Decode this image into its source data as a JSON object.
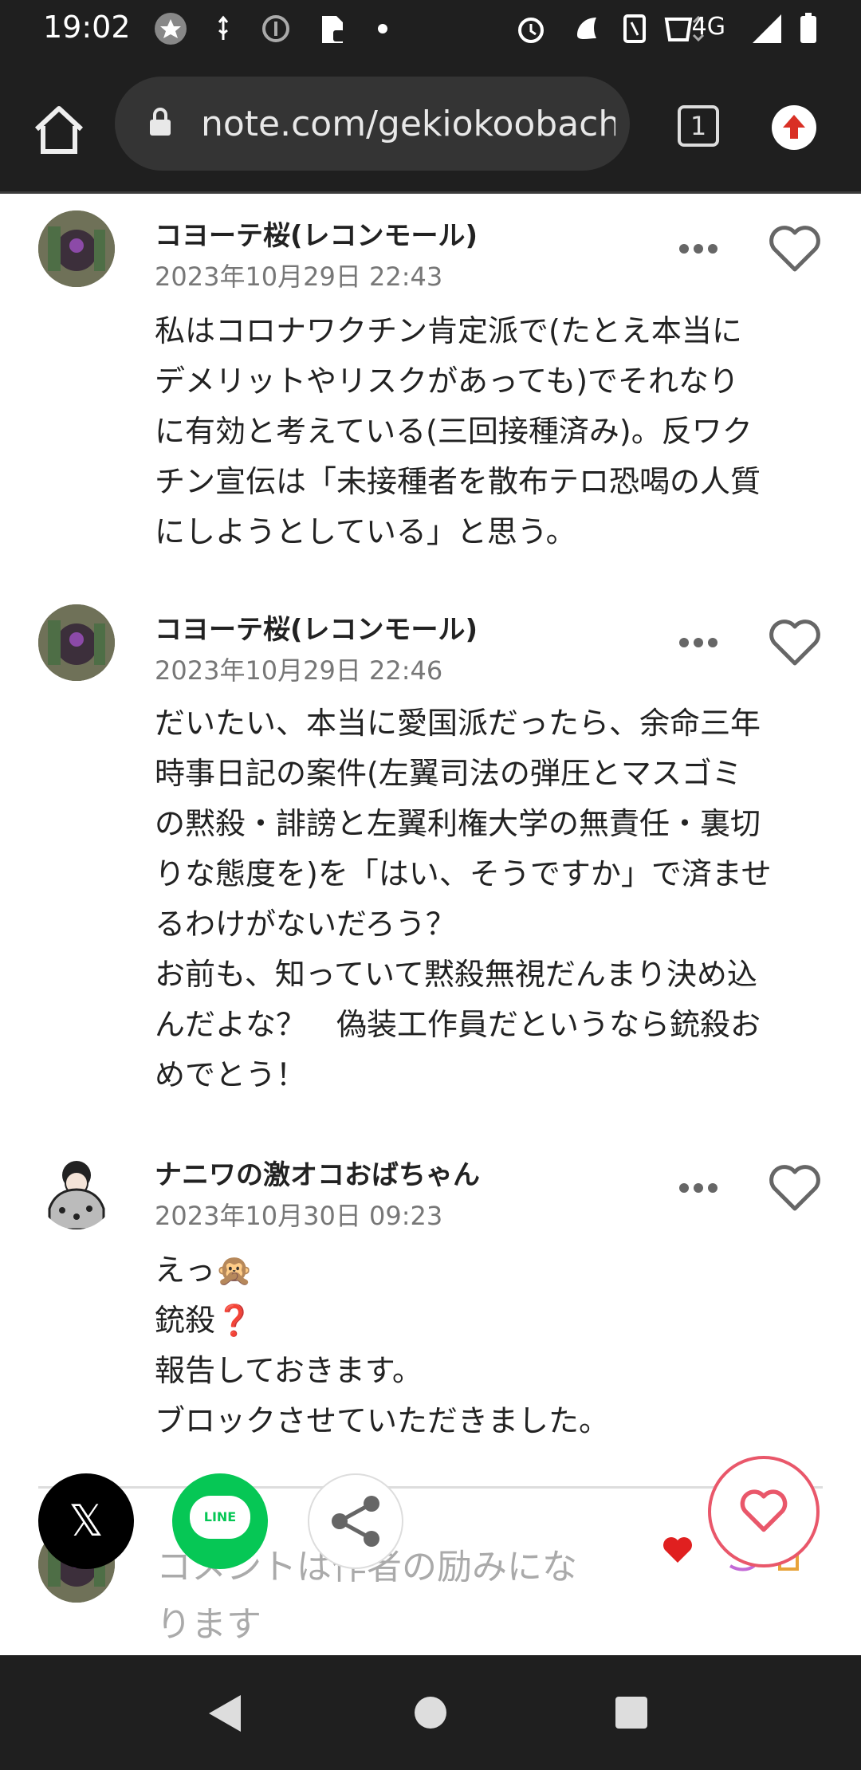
{
  "status_bar": {
    "time": "19:02",
    "network": "4G"
  },
  "browser": {
    "url": "note.com/gekiokoobach",
    "tab_count": "1"
  },
  "comments": [
    {
      "author": "コヨーテ桜(レコンモール)",
      "date": "2023年10月29日 22:43",
      "body": "私はコロナワクチン肯定派で(たとえ本当に\nデメリットやリスクがあっても)でそれなり\nに有効と考えている(三回接種済み)。反ワク\nチン宣伝は「未接種者を散布テロ恐喝の人質\nにしようとしている」と思う。"
    },
    {
      "author": "コヨーテ桜(レコンモール)",
      "date": "2023年10月29日 22:46",
      "body": "だいたい、本当に愛国派だったら、余命三年\n時事日記の案件(左翼司法の弾圧とマスゴミ\nの黙殺・誹謗と左翼利権大学の無責任・裏切\nりな態度を)を「はい、そうですか」で済ませ\nるわけがないだろう？\nお前も、知っていて黙殺無視だんまり決め込\nんだよな？　偽装工作員だというなら銃殺お\nめでとう！"
    },
    {
      "author": "ナニワの激オコおばちゃん",
      "date": "2023年10月30日 09:23",
      "body": "えっ🙊\n銃殺❓\n報告しておきます。\nブロックさせていただきました。"
    }
  ],
  "share": {
    "x_label": "𝕏",
    "line_label": "LINE"
  },
  "comment_input": {
    "placeholder": "コメントは作者の励みにな\nります"
  },
  "colors": {
    "like_accent": "#e9576a",
    "line_green": "#06c755",
    "bar_dark": "#1f1f1f"
  }
}
